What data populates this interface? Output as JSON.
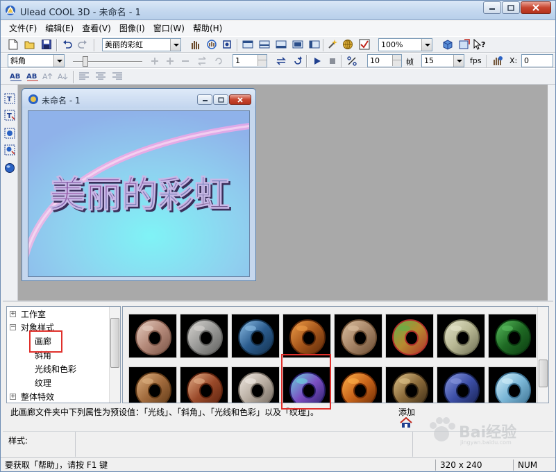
{
  "app": {
    "title": "Ulead COOL 3D - 未命名 - 1"
  },
  "menu": [
    "文件(F)",
    "编辑(E)",
    "查看(V)",
    "图像(I)",
    "窗口(W)",
    "帮助(H)"
  ],
  "toolbar1": {
    "text_combo": "美丽的彩虹",
    "zoom_combo": "100%"
  },
  "toolbar2": {
    "mode_combo": "斜角",
    "frame_value": "1",
    "frames_total": "10",
    "frames_label": "帧",
    "fps_value": "15",
    "fps_label": "fps",
    "x_label": "X:",
    "x_value": "0"
  },
  "doc_window": {
    "title": "未命名 - 1",
    "canvas_text": "美丽的彩虹"
  },
  "tree": {
    "items": [
      {
        "label": "工作室",
        "expander": "+"
      },
      {
        "label": "对象样式",
        "expander": "−"
      },
      {
        "label": "画廊",
        "expander": ""
      },
      {
        "label": "斜角",
        "expander": ""
      },
      {
        "label": "光线和色彩",
        "expander": ""
      },
      {
        "label": "纹理",
        "expander": ""
      },
      {
        "label": "整体特效",
        "expander": "+"
      }
    ]
  },
  "gallery": {
    "description": "此画廊文件夹中下列属性为预设值：「光线」、「斜角」、「光线和色彩」以及「纹理」。",
    "add_label": "添加",
    "thumbnails": [
      {
        "name": "marble-pink-ring",
        "colors": [
          "#b58a7a",
          "#e6cfc2",
          "#7a5446"
        ]
      },
      {
        "name": "granite-grey-ring",
        "colors": [
          "#9a9a98",
          "#d8d6d2",
          "#5f5f5d"
        ]
      },
      {
        "name": "blue-crystal-ring",
        "colors": [
          "#2c5d8f",
          "#8fc1e8",
          "#12304d"
        ]
      },
      {
        "name": "copper-wood-ring",
        "colors": [
          "#a8581c",
          "#f2a04a",
          "#5a2708"
        ]
      },
      {
        "name": "woven-tan-ring",
        "colors": [
          "#a88668",
          "#dcc0a0",
          "#6a4c32"
        ]
      },
      {
        "name": "mosaic-colorful-ring",
        "colors": [
          "#b88a30",
          "#5fb24a",
          "#b0302a"
        ]
      },
      {
        "name": "pale-stone-ring",
        "colors": [
          "#b8b894",
          "#e6e6cc",
          "#6f6f54"
        ]
      },
      {
        "name": "green-marble-ring",
        "colors": [
          "#1f6b24",
          "#5cc061",
          "#0b3a10"
        ]
      },
      {
        "name": "brown-wood-ring",
        "colors": [
          "#a06a3c",
          "#deb282",
          "#5e3816"
        ]
      },
      {
        "name": "red-granite-ring",
        "colors": [
          "#9a4a2a",
          "#e4b08a",
          "#5a200c"
        ]
      },
      {
        "name": "white-marble-ring",
        "colors": [
          "#b9aea2",
          "#f0e9e2",
          "#6e655c"
        ]
      },
      {
        "name": "rainbow-light-ring",
        "colors": [
          "#7b4fc2",
          "#6ad8e0",
          "#2a1e6a"
        ]
      },
      {
        "name": "orange-flame-ring",
        "colors": [
          "#c8641a",
          "#ffb04a",
          "#6a2a04"
        ]
      },
      {
        "name": "leopard-ring",
        "colors": [
          "#8a6a3a",
          "#e0c48a",
          "#3a2a14"
        ]
      },
      {
        "name": "blue-speckle-ring",
        "colors": [
          "#3c4ea6",
          "#8a9ae0",
          "#16204e"
        ]
      },
      {
        "name": "pale-cyan-ring",
        "colors": [
          "#7ab6d6",
          "#d4f0fa",
          "#3a6e8e"
        ]
      }
    ]
  },
  "style_panel": {
    "label": "样式:"
  },
  "statusbar": {
    "help_text": "要获取「帮助」，请按 F1 键",
    "size_text": "320 x 240",
    "num_text": "NUM"
  },
  "watermark": {
    "text": "Bai经验",
    "sub": "jingyan.baidu.com"
  },
  "colors": {
    "highlight": "#e0302b",
    "workspace": "#a9a9a9"
  }
}
